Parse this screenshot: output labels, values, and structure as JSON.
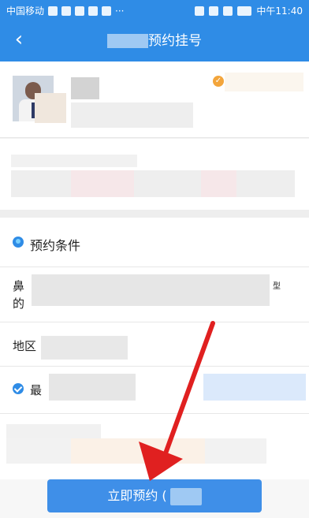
{
  "status": {
    "carrier": "中国移动",
    "time": "中午11:40",
    "dots": "···"
  },
  "appbar": {
    "title": "预约挂号",
    "back_icon": "chevron-left-icon"
  },
  "doctor": {
    "name": ""
  },
  "conditions": {
    "header": "预约条件",
    "row1_label": "鼻",
    "row1_label2": "的",
    "row1_tail": "型",
    "row2_label": "地区",
    "row3_label": "最"
  },
  "cta": {
    "label": "立即预约 ("
  },
  "colors": {
    "primary": "#2f8ce6",
    "accent": "#f3a53b",
    "annotation": "#e02020"
  }
}
